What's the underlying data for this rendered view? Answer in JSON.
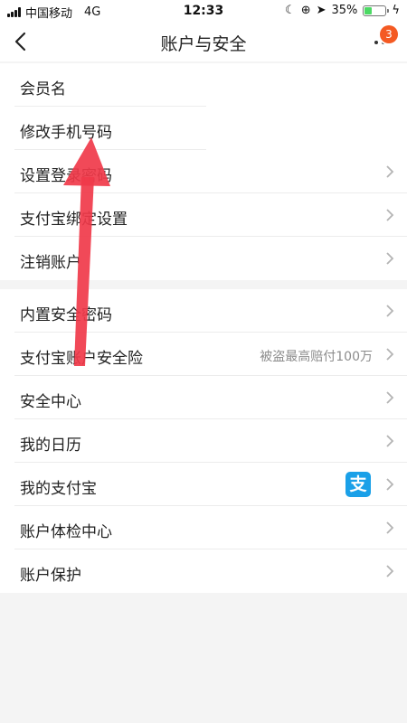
{
  "status_bar": {
    "carrier": "中国移动",
    "network": "4G",
    "time": "12:33",
    "battery": "35%"
  },
  "nav": {
    "title": "账户与安全",
    "badge": "3"
  },
  "group1": [
    {
      "label": "会员名"
    },
    {
      "label": "修改手机号码"
    },
    {
      "label": "设置登录密码"
    },
    {
      "label": "支付宝绑定设置"
    },
    {
      "label": "注销账户"
    }
  ],
  "group2": [
    {
      "label": "内置安全密码"
    },
    {
      "label": "支付宝账户安全险",
      "sub": "被盗最高赔付100万"
    },
    {
      "label": "安全中心"
    },
    {
      "label": "我的日历"
    },
    {
      "label": "我的支付宝",
      "icon_text": "支"
    },
    {
      "label": "账户体检中心"
    },
    {
      "label": "账户保护"
    }
  ],
  "colors": {
    "badge": "#f45a23",
    "alipay": "#1aa0e8",
    "annotation_arrow": "#f03a4a"
  }
}
